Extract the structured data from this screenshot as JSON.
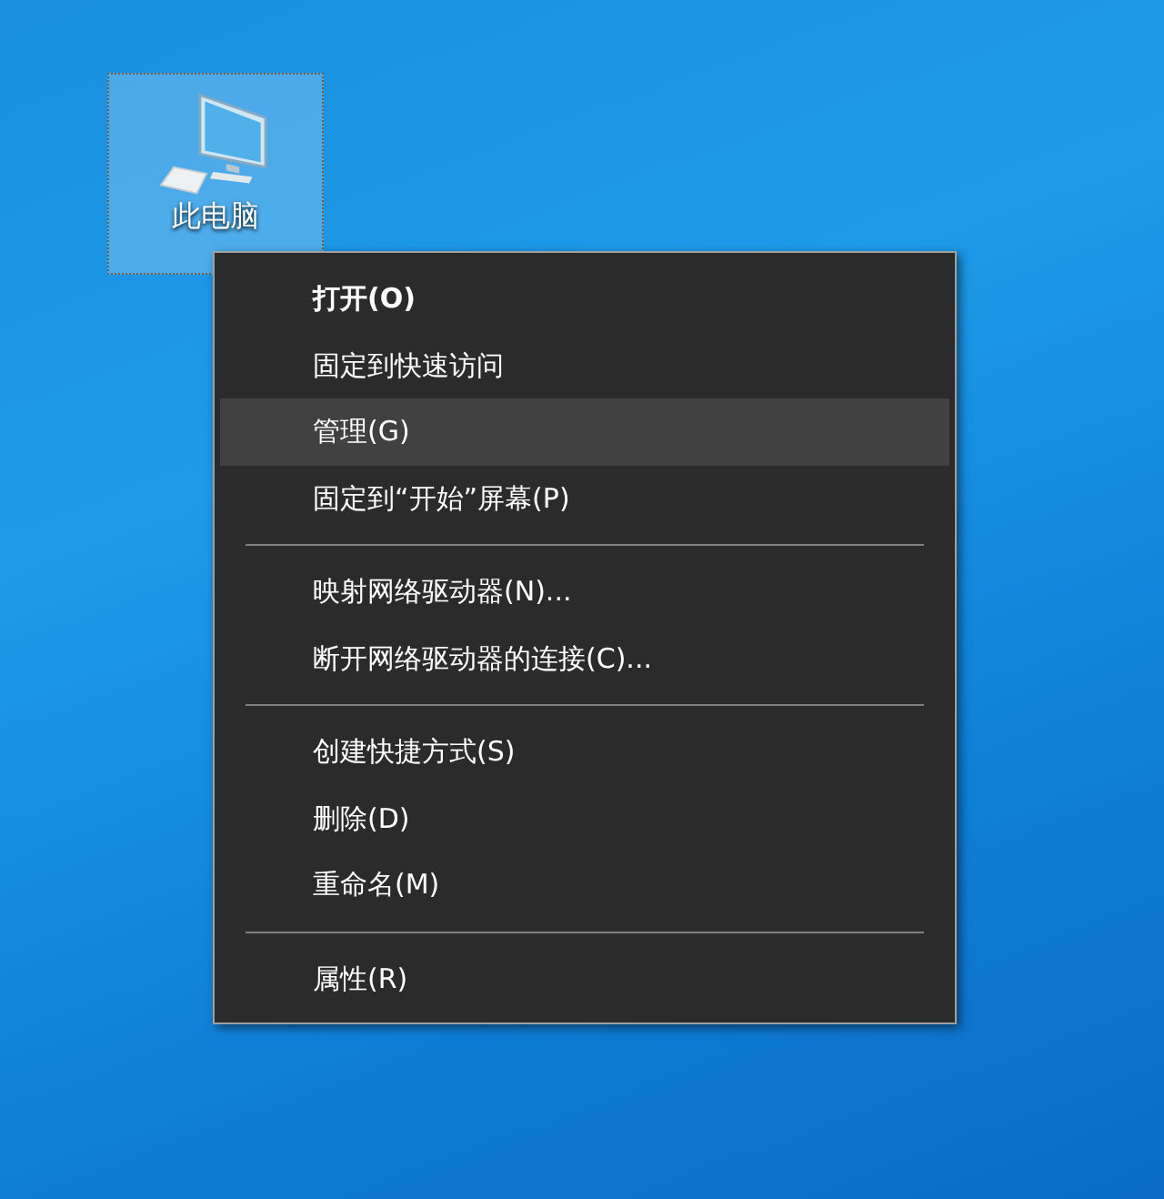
{
  "desktop_icon": {
    "label": "此电脑",
    "selected": true
  },
  "context_menu": {
    "items": [
      {
        "kind": "item",
        "label": "打开(O)",
        "default": true,
        "selected": false
      },
      {
        "kind": "item",
        "label": "固定到快速访问",
        "default": false,
        "selected": false
      },
      {
        "kind": "item",
        "label": "管理(G)",
        "default": false,
        "selected": true
      },
      {
        "kind": "item",
        "label": "固定到“开始”屏幕(P)",
        "default": false,
        "selected": false
      },
      {
        "kind": "separator"
      },
      {
        "kind": "item",
        "label": "映射网络驱动器(N)...",
        "default": false,
        "selected": false
      },
      {
        "kind": "item",
        "label": "断开网络驱动器的连接(C)...",
        "default": false,
        "selected": false
      },
      {
        "kind": "separator"
      },
      {
        "kind": "item",
        "label": "创建快捷方式(S)",
        "default": false,
        "selected": false
      },
      {
        "kind": "item",
        "label": "删除(D)",
        "default": false,
        "selected": false
      },
      {
        "kind": "item",
        "label": "重命名(M)",
        "default": false,
        "selected": false
      },
      {
        "kind": "separator"
      },
      {
        "kind": "item",
        "label": "属性(R)",
        "default": false,
        "selected": false
      }
    ]
  }
}
